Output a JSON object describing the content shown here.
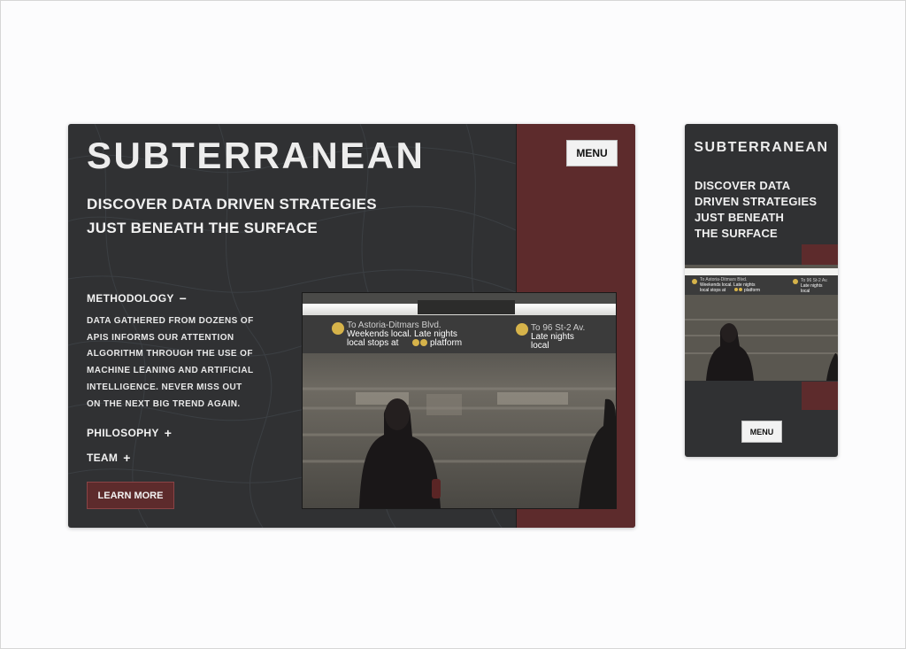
{
  "desktop": {
    "logo": "SUBTERRANEAN",
    "menu_label": "MENU",
    "tagline_line1": "DISCOVER DATA DRIVEN STRATEGIES",
    "tagline_line2": "JUST BENEATH THE SURFACE",
    "accordion": [
      {
        "label": "METHODOLOGY",
        "sign": "−",
        "expanded": true
      },
      {
        "label": "PHILOSOPHY",
        "sign": "+",
        "expanded": false
      },
      {
        "label": "TEAM",
        "sign": "+",
        "expanded": false
      }
    ],
    "methodology_body": [
      "DATA GATHERED FROM DOZENS OF",
      "APIS INFORMS OUR ATTENTION",
      "ALGORITHM THROUGH THE USE OF",
      "MACHINE LEANING AND ARTIFICIAL",
      "INTELLIGENCE. NEVER MISS OUT",
      "ON THE NEXT BIG TREND AGAIN."
    ],
    "cta_label": "LEARN MORE",
    "photo": {
      "sign_line1": "To Astoria-Ditmars Blvd.",
      "sign_line2": "Weekends local. Late nights",
      "sign_line3": "local stops at",
      "sign_line3_end": "platform",
      "sign_right1": "To 96 St-2 Av.",
      "sign_right2": "Late nights",
      "sign_right3": "local"
    }
  },
  "mobile": {
    "logo": "SUBTERRANEAN",
    "tagline_lines": [
      "DISCOVER DATA",
      "DRIVEN STRATEGIES",
      "JUST BENEATH",
      "THE SURFACE"
    ],
    "menu_label": "MENU",
    "photo": {
      "sign_line1": "To Astoria-Ditmars Blvd.",
      "sign_line2": "Weekends local. Late nights",
      "sign_line3": "local stops at",
      "sign_line3_end": "platform",
      "sign_right1": "To 96 St-2 Av.",
      "sign_right2": "Late nights",
      "sign_right3": "local"
    }
  },
  "colors": {
    "panel": "#303133",
    "accent": "#5d2b2c",
    "text": "#f0f0f0",
    "button_light": "#f2f2f2"
  }
}
